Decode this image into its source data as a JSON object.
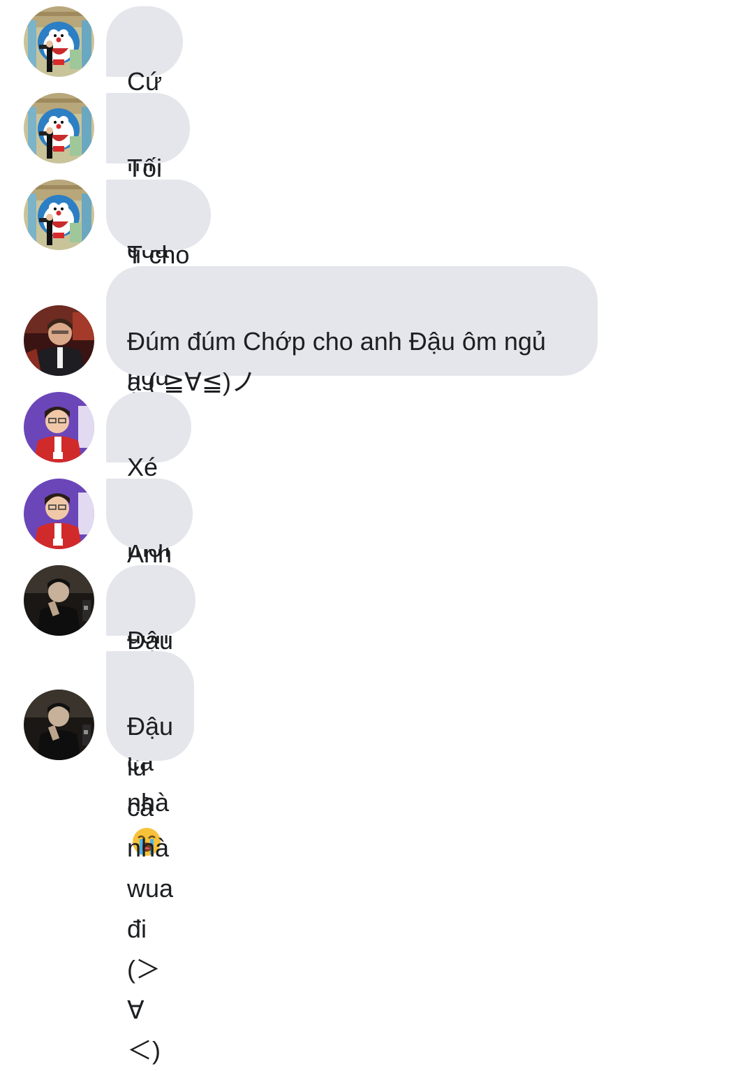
{
  "messages": [
    {
      "sender": "doraemon-user",
      "text": "Cứ để mn lo đi"
    },
    {
      "sender": "doraemon-user",
      "text": "Tối nay qua đây"
    },
    {
      "sender": "doraemon-user",
      "text": "T cho ôm Chớp ngủ"
    },
    {
      "sender": "dark-red-user",
      "text": "Đúm đúm Chớp cho anh Đậu ôm ngủ\nạ ( ≧∀≦)ノ"
    },
    {
      "sender": "purple-user",
      "text": "Xé thư mời đi"
    },
    {
      "sender": "purple-user",
      "text": "Anh qua đón em đây"
    },
    {
      "sender": "dark-user",
      "text": "Đậu cảm ơn cả nhà",
      "emoji": "loudly-crying-face"
    },
    {
      "sender": "dark-user",
      "text": "Đậu iu cả nhà wua đi\n(＞∀＜)"
    }
  ],
  "colors": {
    "bubble": "#e4e6eb",
    "text": "#1c1e21",
    "background": "#ffffff"
  }
}
